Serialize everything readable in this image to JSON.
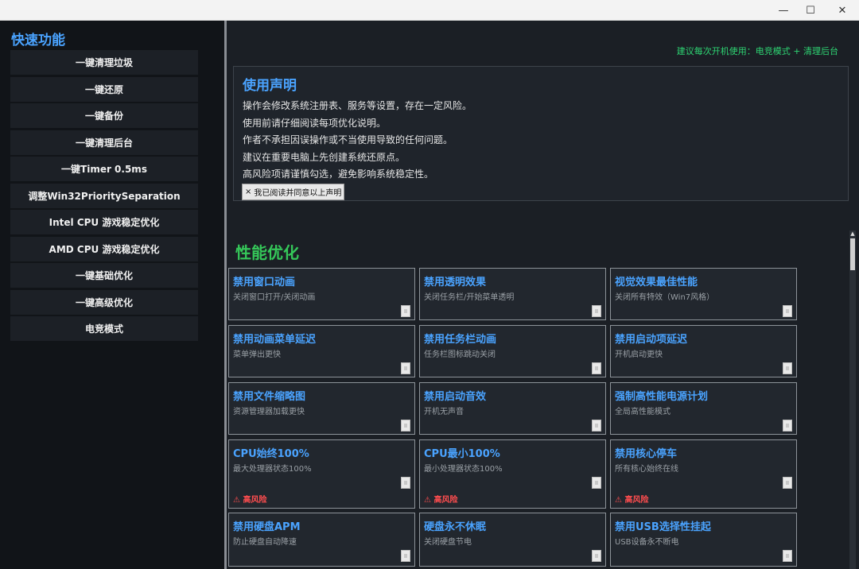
{
  "window": {
    "minimize_icon": "minimize-icon",
    "maximize_icon": "maximize-icon",
    "close_icon": "close-icon",
    "minimize_glyph": "—",
    "maximize_glyph": "☐",
    "close_glyph": "✕"
  },
  "sidebar": {
    "title": "快速功能",
    "items": [
      {
        "label": "一键清理垃圾"
      },
      {
        "label": "一键还原"
      },
      {
        "label": "一键备份"
      },
      {
        "label": "一键清理后台"
      },
      {
        "label": "一键Timer 0.5ms"
      },
      {
        "label": "调整Win32PrioritySeparation"
      },
      {
        "label": "Intel CPU 游戏稳定优化"
      },
      {
        "label": "AMD CPU 游戏稳定优化"
      },
      {
        "label": "一键基础优化"
      },
      {
        "label": "一键高级优化"
      },
      {
        "label": "电竞模式"
      }
    ]
  },
  "tip": "建议每次开机使用：电竞模式 + 清理后台",
  "disclaimer": {
    "title": "使用声明",
    "lines": [
      "操作会修改系统注册表、服务等设置，存在一定风险。",
      "使用前请仔细阅读每项优化说明。",
      "作者不承担因误操作或不当使用导致的任何问题。",
      "建议在重要电脑上先创建系统还原点。",
      "高风险项请谨慎勾选，避免影响系统稳定性。"
    ],
    "agree_mark": "×",
    "agree_label": "我已阅读并同意以上声明"
  },
  "section": {
    "title": "性能优化"
  },
  "cards": [
    {
      "title": "禁用窗口动画",
      "desc": "关闭窗口打开/关闭动画",
      "risk": ""
    },
    {
      "title": "禁用透明效果",
      "desc": "关闭任务栏/开始菜单透明",
      "risk": ""
    },
    {
      "title": "视觉效果最佳性能",
      "desc": "关闭所有特效（Win7风格）",
      "risk": ""
    },
    {
      "title": "禁用动画菜单延迟",
      "desc": "菜单弹出更快",
      "risk": ""
    },
    {
      "title": "禁用任务栏动画",
      "desc": "任务栏图标跳动关闭",
      "risk": ""
    },
    {
      "title": "禁用启动项延迟",
      "desc": "开机启动更快",
      "risk": ""
    },
    {
      "title": "禁用文件缩略图",
      "desc": "资源管理器加载更快",
      "risk": ""
    },
    {
      "title": "禁用启动音效",
      "desc": "开机无声音",
      "risk": ""
    },
    {
      "title": "强制高性能电源计划",
      "desc": "全局高性能模式",
      "risk": ""
    },
    {
      "title": "CPU始终100%",
      "desc": "最大处理器状态100%",
      "risk": "⚠ 高风险"
    },
    {
      "title": "CPU最小100%",
      "desc": "最小处理器状态100%",
      "risk": "⚠ 高风险"
    },
    {
      "title": "禁用核心停车",
      "desc": "所有核心始终在线",
      "risk": "⚠ 高风险"
    },
    {
      "title": "禁用硬盘APM",
      "desc": "防止硬盘自动降速",
      "risk": ""
    },
    {
      "title": "硬盘永不休眠",
      "desc": "关闭硬盘节电",
      "risk": ""
    },
    {
      "title": "禁用USB选择性挂起",
      "desc": "USB设备永不断电",
      "risk": ""
    }
  ],
  "scrollbar": {
    "up_glyph": "▲"
  },
  "colors": {
    "accent_blue": "#4aa3ff",
    "section_green": "#35c759",
    "tip_green": "#2ed573",
    "risk_red": "#ff4d4f",
    "background": "#1b1f25",
    "sidebar_bg": "#111418"
  }
}
